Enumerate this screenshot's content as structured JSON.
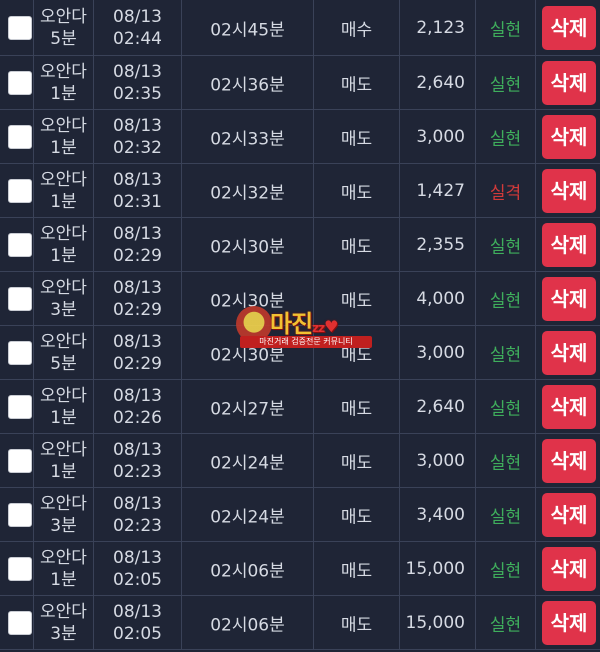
{
  "rows": [
    {
      "game_1": "오안다",
      "game_2": "5분",
      "date": "08/13",
      "time": "02:44",
      "round": "02시45분",
      "type": "매수",
      "amount": "2,123",
      "result": "실현",
      "result_status": "win",
      "delete_label": "삭제"
    },
    {
      "game_1": "오안다",
      "game_2": "1분",
      "date": "08/13",
      "time": "02:35",
      "round": "02시36분",
      "type": "매도",
      "amount": "2,640",
      "result": "실현",
      "result_status": "win",
      "delete_label": "삭제"
    },
    {
      "game_1": "오안다",
      "game_2": "1분",
      "date": "08/13",
      "time": "02:32",
      "round": "02시33분",
      "type": "매도",
      "amount": "3,000",
      "result": "실현",
      "result_status": "win",
      "delete_label": "삭제"
    },
    {
      "game_1": "오안다",
      "game_2": "1분",
      "date": "08/13",
      "time": "02:31",
      "round": "02시32분",
      "type": "매도",
      "amount": "1,427",
      "result": "실격",
      "result_status": "lose",
      "delete_label": "삭제"
    },
    {
      "game_1": "오안다",
      "game_2": "1분",
      "date": "08/13",
      "time": "02:29",
      "round": "02시30분",
      "type": "매도",
      "amount": "2,355",
      "result": "실현",
      "result_status": "win",
      "delete_label": "삭제"
    },
    {
      "game_1": "오안다",
      "game_2": "3분",
      "date": "08/13",
      "time": "02:29",
      "round": "02시30분",
      "type": "매도",
      "amount": "4,000",
      "result": "실현",
      "result_status": "win",
      "delete_label": "삭제"
    },
    {
      "game_1": "오안다",
      "game_2": "5분",
      "date": "08/13",
      "time": "02:29",
      "round": "02시30분",
      "type": "매도",
      "amount": "3,000",
      "result": "실현",
      "result_status": "win",
      "delete_label": "삭제"
    },
    {
      "game_1": "오안다",
      "game_2": "1분",
      "date": "08/13",
      "time": "02:26",
      "round": "02시27분",
      "type": "매도",
      "amount": "2,640",
      "result": "실현",
      "result_status": "win",
      "delete_label": "삭제"
    },
    {
      "game_1": "오안다",
      "game_2": "1분",
      "date": "08/13",
      "time": "02:23",
      "round": "02시24분",
      "type": "매도",
      "amount": "3,000",
      "result": "실현",
      "result_status": "win",
      "delete_label": "삭제"
    },
    {
      "game_1": "오안다",
      "game_2": "3분",
      "date": "08/13",
      "time": "02:23",
      "round": "02시24분",
      "type": "매도",
      "amount": "3,400",
      "result": "실현",
      "result_status": "win",
      "delete_label": "삭제"
    },
    {
      "game_1": "오안다",
      "game_2": "1분",
      "date": "08/13",
      "time": "02:05",
      "round": "02시06분",
      "type": "매도",
      "amount": "15,000",
      "result": "실현",
      "result_status": "win",
      "delete_label": "삭제"
    },
    {
      "game_1": "오안다",
      "game_2": "3분",
      "date": "08/13",
      "time": "02:05",
      "round": "02시06분",
      "type": "매도",
      "amount": "15,000",
      "result": "실현",
      "result_status": "win",
      "delete_label": "삭제"
    }
  ],
  "watermark": {
    "title": "마진",
    "title_suffix": "zz",
    "subtitle": "마진거래 검증전문 커뮤니티"
  },
  "colors": {
    "background": "#1f2536",
    "win": "#3fae5c",
    "lose": "#d23a3a",
    "delete_button": "#e0334a"
  }
}
